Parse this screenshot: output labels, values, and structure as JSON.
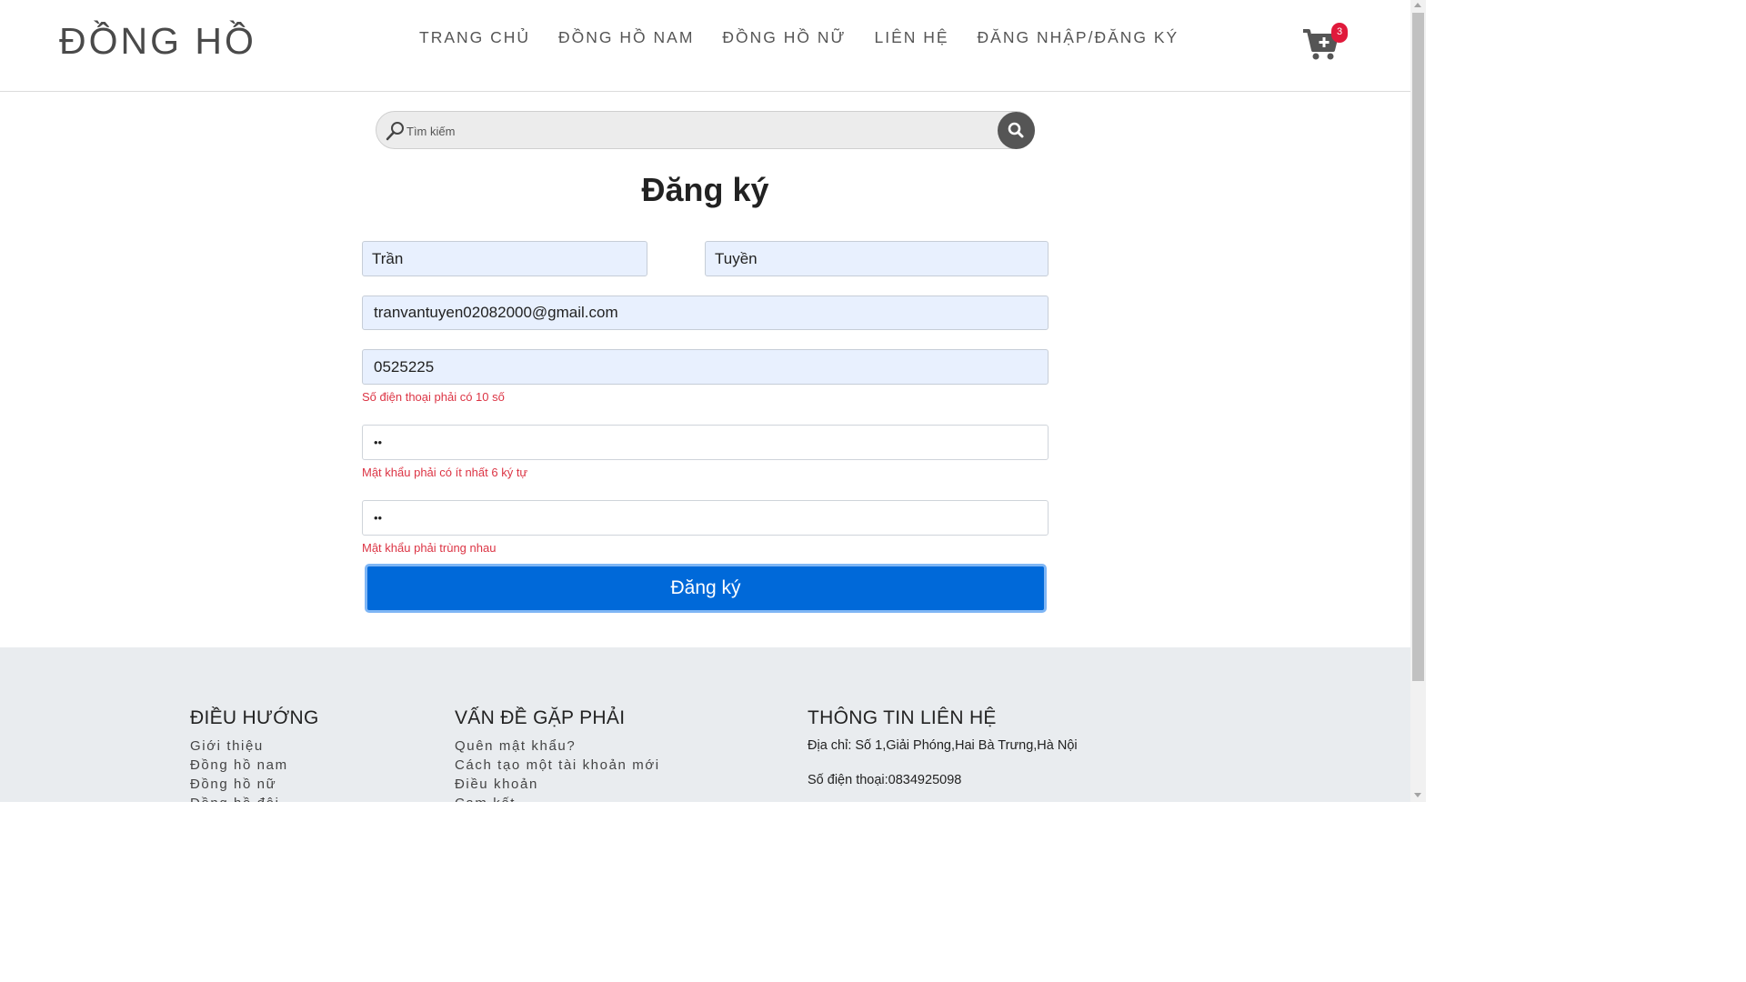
{
  "header": {
    "logo": "ĐỒNG HỒ",
    "nav": [
      {
        "label": "TRANG CHỦ"
      },
      {
        "label": "ĐỒNG HỒ NAM"
      },
      {
        "label": "ĐỒNG HỒ NỮ"
      },
      {
        "label": "LIÊN HỆ"
      },
      {
        "label": "ĐĂNG NHẬP/ĐĂNG KÝ"
      }
    ],
    "cart": {
      "icon": "cart-plus-icon",
      "count": "3"
    }
  },
  "search": {
    "placeholder": "Tìm kiếm",
    "value": "",
    "icon": "search-icon"
  },
  "form": {
    "title": "Đăng ký",
    "first_name": "Trần",
    "last_name": "Tuyền",
    "email": "tranvantuyen02082000@gmail.com",
    "phone": "0525225",
    "phone_error": "Số điện thoại phải có 10 số",
    "password": "••",
    "password_error": "Mật khẩu phải có ít nhất 6 ký tự",
    "confirm_password": "••",
    "confirm_error": "Mật khẩu phải trùng nhau",
    "submit_label": "Đăng ký"
  },
  "footer": {
    "nav_title": "ĐIỀU HƯỚNG",
    "nav_links": [
      "Giới thiệu",
      "Đồng hồ nam",
      "Đồng hồ nữ",
      "Đồng hồ đôi"
    ],
    "issues_title": "VẤN ĐỀ GẶP PHẢI",
    "issues_links": [
      "Quên mật khẩu?",
      "Cách tạo một tài khoản mới",
      "Điều khoản",
      "Cam kết"
    ],
    "contact_title": "THÔNG TIN LIÊN HỆ",
    "address": "Địa chỉ: Số 1,Giải Phóng,Hai Bà Trưng,Hà Nội",
    "phone": "Số điện thoại:0834925098"
  },
  "colors": {
    "primary_button": "#0069d9",
    "error": "#dc3545",
    "badge": "#e0193b",
    "autofill_field": "#e8f0fe",
    "footer_bg": "#e9ecef"
  }
}
